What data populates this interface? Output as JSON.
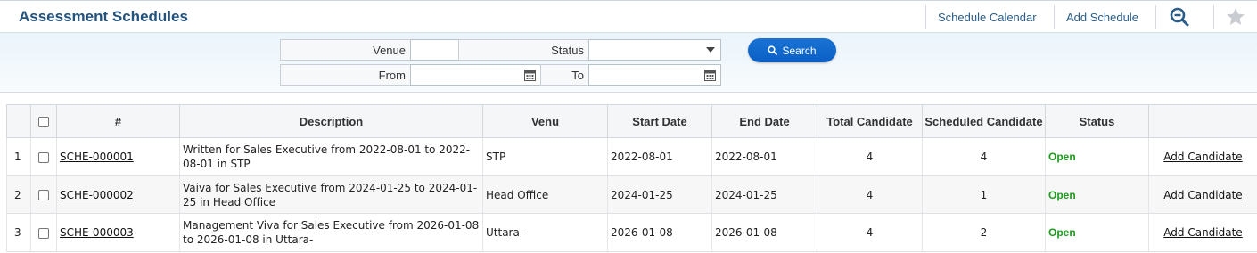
{
  "header": {
    "title": "Assessment Schedules",
    "links": {
      "schedule_calendar": "Schedule Calendar",
      "add_schedule": "Add Schedule"
    },
    "icons": [
      "zoom-out-icon",
      "star-icon"
    ]
  },
  "filters": {
    "venue_label": "Venue",
    "venue_value": "",
    "status_label": "Status",
    "status_value": "",
    "from_label": "From",
    "from_value": "",
    "to_label": "To",
    "to_value": "",
    "search_label": "Search"
  },
  "table": {
    "columns": {
      "hash": "#",
      "description": "Description",
      "venu": "Venu",
      "start_date": "Start Date",
      "end_date": "End Date",
      "total_candidate": "Total Candidate",
      "scheduled_candidate": "Scheduled Candidate",
      "status": "Status"
    },
    "rows": [
      {
        "index": "1",
        "code": "SCHE-000001",
        "description": "Written for Sales Executive from 2022-08-01 to 2022-08-01 in STP",
        "venu": "STP",
        "start": "2022-08-01",
        "end": "2022-08-01",
        "total": "4",
        "scheduled": "4",
        "status": "Open",
        "action": "Add Candidate"
      },
      {
        "index": "2",
        "code": "SCHE-000002",
        "description": "Vaiva for Sales Executive from 2024-01-25 to 2024-01-25 in Head Office",
        "venu": "Head Office",
        "start": "2024-01-25",
        "end": "2024-01-25",
        "total": "4",
        "scheduled": "1",
        "status": "Open",
        "action": "Add Candidate"
      },
      {
        "index": "3",
        "code": "SCHE-000003",
        "description": "Management Viva for Sales Executive from 2026-01-08 to 2026-01-08 in Uttara-",
        "venu": "Uttara-",
        "start": "2026-01-08",
        "end": "2026-01-08",
        "total": "4",
        "scheduled": "2",
        "status": "Open",
        "action": "Add Candidate"
      }
    ]
  },
  "colors": {
    "title": "#23527c",
    "link": "#2a5d8a",
    "accent": "#0a5fc4",
    "open": "#1e9a1e"
  }
}
